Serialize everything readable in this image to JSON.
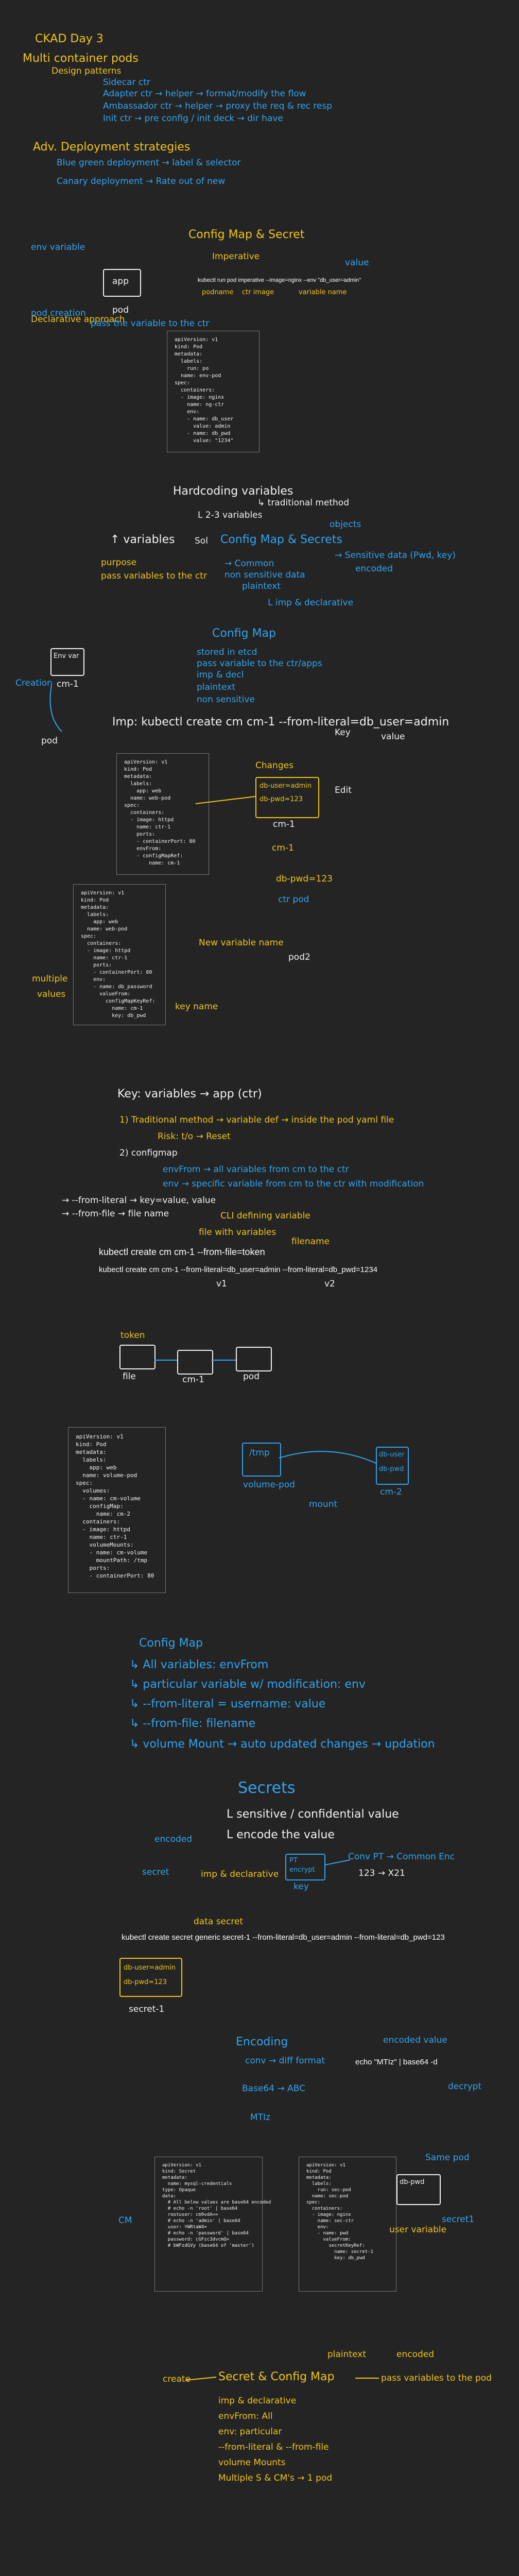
{
  "day_title": "CKAD Day 3",
  "section1": {
    "heading": "Multi container pods",
    "sub": "Design patterns",
    "items": [
      "Sidecar ctr",
      "Adapter ctr → helper → format/modify the flow",
      "Ambassador ctr → helper → proxy the req & rec resp",
      "Init ctr → pre config / init deck → dir have"
    ]
  },
  "section2": {
    "heading": "Adv. Deployment strategies",
    "items": [
      "Blue green deployment → label & selector",
      "Canary deployment → Rate out of new"
    ]
  },
  "config_map_secret": {
    "title": "Config Map & Secret",
    "labels": [
      "Imperative",
      "Declarative approach",
      "app",
      "pod",
      "env variable",
      "value",
      "pod creation",
      "pass the variable to the ctr"
    ],
    "cmd": "kubectl run pod imperative --image=nginx --env \"db_user=admin\"",
    "cmd_parts": [
      "podname",
      "ctr image",
      "variable name"
    ],
    "yaml": [
      "apiVersion: v1",
      "kind: Pod",
      "metadata:",
      "  labels:",
      "    run: po",
      "  name: env-pod",
      "spec:",
      "  containers:",
      "  - image: nginx",
      "    name: ng-ctr",
      "    env:",
      "    - name: db_user",
      "      value: admin",
      "    - name: db_pwd",
      "      value: \"1234\""
    ]
  },
  "hardcoding": {
    "title": "Hardcoding variables",
    "sub": "↳ traditional method",
    "sub2": "L 2-3 variables",
    "vars": "↑ variables",
    "small": "Sol",
    "config_map_secrets": "Config Map & Secrets",
    "objects": "objects",
    "purpose": "purpose",
    "pass_vars": "pass variables to the ctr",
    "list": [
      "→ Common",
      "non sensitive data",
      "plaintext",
      "L imp & declarative"
    ],
    "sensitive": [
      "→ Sensitive data (Pwd, key)",
      "encoded"
    ]
  },
  "config_map": {
    "title": "Config Map",
    "points": [
      "stored in etcd",
      "pass variable to the ctr/apps",
      "imp & decl",
      "plaintext",
      "non sensitive"
    ],
    "labels": [
      "Env var",
      "cm-1",
      "pod",
      "Creation"
    ],
    "cmd": "Imp: kubectl create cm cm-1 --from-literal=db_user=admin",
    "cmd_labels": [
      "Key",
      "value"
    ],
    "pod_yaml": [
      "apiVersion: v1",
      "kind: Pod",
      "metadata:",
      "  labels:",
      "    app: web",
      "  name: web-pod",
      "spec:",
      "  containers:",
      "  - image: httpd",
      "    name: ctr-1",
      "    ports:",
      "    - containerPort: 80",
      "    envFrom:",
      "    - configMapRef:",
      "        name: cm-1"
    ],
    "pod2_yaml": [
      "apiVersion: v1",
      "kind: Pod",
      "metadata:",
      "  labels:",
      "    app: web",
      "  name: web-pod",
      "spec:",
      "  containers:",
      "  - image: httpd",
      "    name: ctr-1",
      "    ports:",
      "    - containerPort: 80",
      "    env:",
      "    - name: db_password",
      "      valueFrom:",
      "        configMapKeyRef:",
      "          name: cm-1",
      "          key: db_pwd"
    ],
    "notes": [
      "Changes",
      "db-user=admin",
      "db-pwd=123",
      "cm-1",
      "Edit",
      "cm-1",
      "db-pwd=123",
      "New variable name",
      "pod2",
      "key name",
      "multiple",
      "ctr pod",
      "values"
    ]
  },
  "keyvals": {
    "title": "Key: variables → app (ctr)",
    "line1": "1) Traditional method → variable def → inside the pod yaml file",
    "line1b": "Risk: t/o → Reset",
    "line2": "2) configmap",
    "items": [
      "envFrom → all variables from cm to the ctr",
      "env → specific variable from cm to the ctr with modification",
      "→ --from-literal → key=value, value",
      "→ --from-file → file name",
      "CLI defining variable",
      "file with variables"
    ],
    "cmd1": "kubectl create cm cm-1 --from-file=token",
    "cmd1_label": "filename",
    "cmd2": "kubectl create cm cm-1 --from-literal=db_user=admin --from-literal=db_pwd=1234",
    "cmd2_labels": [
      "v1",
      "v2"
    ],
    "boxes": [
      "token",
      "file",
      "cm-1",
      "pod"
    ]
  },
  "volume": {
    "yaml": [
      "apiVersion: v1",
      "kind: Pod",
      "metadata:",
      "  labels:",
      "    app: web",
      "  name: volume-pod",
      "spec:",
      "  volumes:",
      "  - name: cm-volume",
      "    configMap:",
      "      name: cm-2",
      "  containers:",
      "  - image: httpd",
      "    name: ctr-1",
      "    volumeMounts:",
      "    - name: cm-volume",
      "      mountPath: /tmp",
      "    ports:",
      "    - containerPort: 80"
    ],
    "labels": [
      "/tmp",
      "volume-pod",
      "mount",
      "cm-2",
      "db-user",
      "db-pwd"
    ]
  },
  "summary": {
    "title": "Config Map",
    "items": [
      "↳ All variables: envFrom",
      "↳ particular variable w/ modification: env",
      "↳ --from-literal = username: value",
      "↳ --from-file: filename",
      "↳ volume Mount → auto updated changes → updation"
    ]
  },
  "secrets": {
    "title": "Secrets",
    "points": [
      "L sensitive / confidential value",
      "L encode the value"
    ],
    "encode_labels": [
      "encoded",
      "secret",
      "imp & declarative",
      "Conv PT → Common Enc",
      "123 → X21",
      "PT",
      "encrypt",
      "key"
    ],
    "cmd": "kubectl create secret generic secret-1 --from-literal=db_user=admin --from-literal=db_pwd=123",
    "cmd_labels": [
      "data secret"
    ],
    "box": [
      "db-user=admin",
      "db-pwd=123"
    ],
    "box_label": "secret-1",
    "encoding": "Encoding",
    "enc_line": "conv → diff format",
    "echo": "echo \"MTIz\" | base64 -d",
    "encoded_value": "encoded value",
    "decrypt": "decrypt",
    "base_flow": "Base64 → ABC",
    "mtiz": "MTIz",
    "secret_yaml": [
      "apiVersion: v1",
      "kind: Secret",
      "metadata:",
      "  name: mysql-credentials",
      "type: Opaque",
      "data:",
      "  # All below values are base64 encoded",
      "  # echo -n 'root' | base64",
      "  rootuser: cm9vdA==",
      "  # echo -n 'admin' | base64",
      "  user: YWRtaW4=",
      "  # echo -n 'password' | base64",
      "  password: cGFzc3dvcmQ=",
      "  # bWFzdGVy (base64 of 'master')"
    ],
    "secret_pod_yaml": [
      "apiVersion: v1",
      "kind: Pod",
      "metadata:",
      "  labels:",
      "    run: sec-pod",
      "  name: sec-pod",
      "spec:",
      "  containers:",
      "  - image: nginx",
      "    name: sec-ctr",
      "    env:",
      "    - name: pwd",
      "      valueFrom:",
      "        secretKeyRef:",
      "          name: secret-1",
      "          key: db_pwd"
    ],
    "secret_labels": [
      "CM",
      "Same pod",
      "user variable",
      "db-pwd",
      "secret1"
    ]
  },
  "final": {
    "label": "create",
    "title": "Secret & Config Map",
    "target": "pass variables to the pod",
    "plaintext": "plaintext",
    "encoded": "encoded",
    "items": [
      "imp & declarative",
      "envFrom: All",
      "env: particular",
      "--from-literal & --from-file",
      "volume Mounts",
      "Multiple S & CM's → 1 pod"
    ]
  }
}
